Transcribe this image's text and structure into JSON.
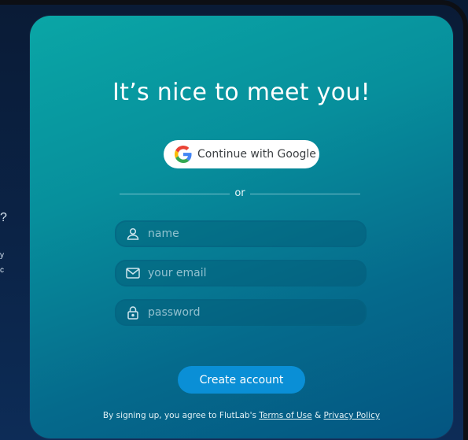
{
  "background": {
    "side_text": [
      "?",
      "y",
      "c"
    ]
  },
  "signup": {
    "title": "It’s nice to meet you!",
    "google_button": {
      "label": "Continue with Google",
      "icon": "google-icon"
    },
    "divider_text": "or",
    "fields": {
      "name": {
        "placeholder": "name",
        "value": "",
        "icon": "person-icon"
      },
      "email": {
        "placeholder": "your email",
        "value": "",
        "icon": "mail-icon"
      },
      "password": {
        "placeholder": "password",
        "value": "",
        "icon": "lock-icon"
      }
    },
    "submit_label": "Create account",
    "legal": {
      "prefix": "By signing up, you agree to FlutLab's ",
      "terms_link": "Terms of Use",
      "joiner": " & ",
      "privacy_link": "Privacy Policy"
    }
  },
  "colors": {
    "card_gradient_start": "#0aa6a6",
    "card_gradient_end": "#045581",
    "primary_button": "#0a8fd6",
    "background": "#0b2448"
  }
}
